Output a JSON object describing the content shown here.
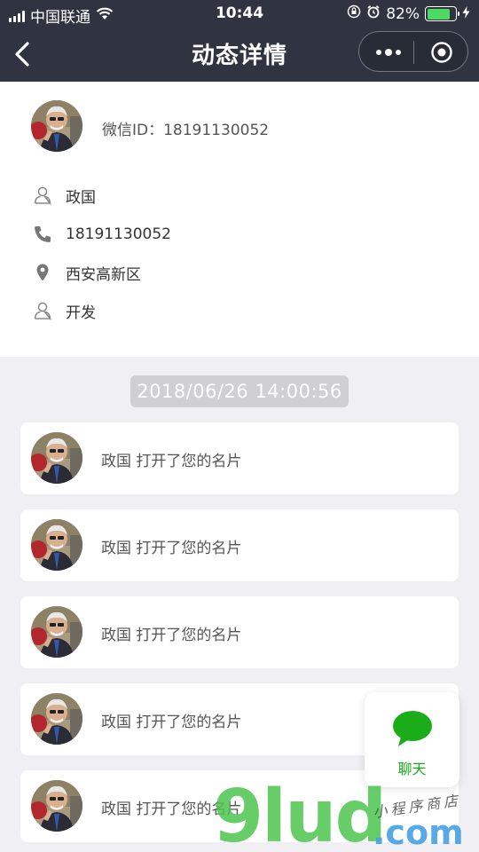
{
  "status_bar": {
    "carrier": "中国联通",
    "time": "10:44",
    "battery_percent": "82%",
    "battery_level": 0.82
  },
  "nav": {
    "title": "动态详情"
  },
  "profile": {
    "wechat_id": "微信ID：18191130052",
    "name": "政国",
    "phone": "18191130052",
    "location": "西安高新区",
    "job": "开发"
  },
  "timeline": {
    "date": "2018/06/26 14:00:56",
    "items": [
      {
        "text": "政国 打开了您的名片"
      },
      {
        "text": "政国 打开了您的名片"
      },
      {
        "text": "政国 打开了您的名片"
      },
      {
        "text": "政国 打开了您的名片"
      },
      {
        "text": "政国 打开了您的名片"
      }
    ]
  },
  "chat_button": {
    "label": "聊天"
  },
  "watermark": {
    "logo": "9lud",
    "domain": ".com",
    "tagline": "小程序商店"
  },
  "colors": {
    "nav_bg": "#2f3440",
    "page_bg": "#efeff4",
    "accent_green": "#1aad19"
  }
}
